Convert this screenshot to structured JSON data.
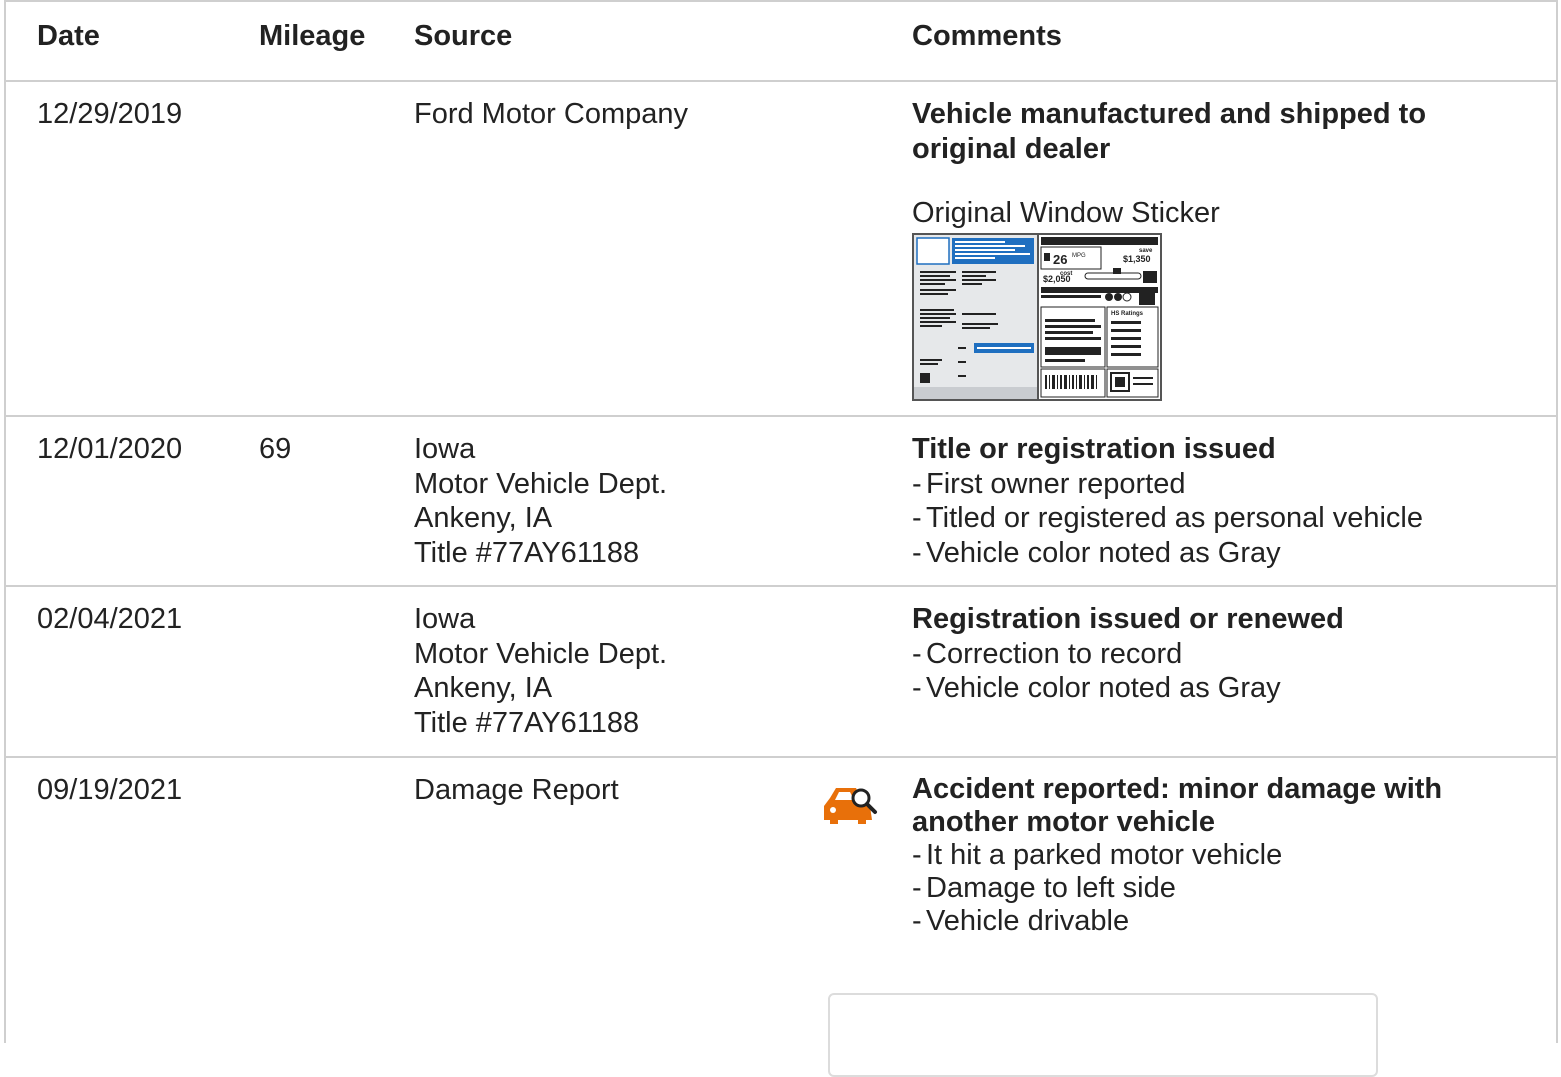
{
  "headers": {
    "date": "Date",
    "mileage": "Mileage",
    "source": "Source",
    "comments": "Comments"
  },
  "rows": [
    {
      "date": "12/29/2019",
      "mileage": "",
      "source": [
        "Ford Motor Company"
      ],
      "title": "Vehicle manufactured and shipped to original dealer",
      "title_lines": [
        "Vehicle manufactured and shipped to",
        "original dealer"
      ],
      "link": "Original Window Sticker",
      "sticker": {
        "mpg": "26",
        "mpg_unit": "MPG",
        "save": "save",
        "save_amount": "$1,350",
        "cost_label": "cost",
        "cost": "$2,050",
        "ratings": "HS Ratings"
      }
    },
    {
      "date": "12/01/2020",
      "mileage": "69",
      "source": [
        "Iowa",
        "Motor Vehicle Dept.",
        "Ankeny, IA",
        "Title #77AY61188"
      ],
      "title": "Title or registration issued",
      "bullets": [
        "First owner reported",
        "Titled or registered as personal vehicle",
        "Vehicle color noted as Gray"
      ]
    },
    {
      "date": "02/04/2021",
      "mileage": "",
      "source": [
        "Iowa",
        "Motor Vehicle Dept.",
        "Ankeny, IA",
        "Title #77AY61188"
      ],
      "title": "Registration issued or renewed",
      "bullets": [
        "Correction to record",
        "Vehicle color noted as Gray"
      ]
    },
    {
      "date": "09/19/2021",
      "mileage": "",
      "source": [
        "Damage Report"
      ],
      "icon": "car-search-icon",
      "title_lines": [
        "Accident reported: minor damage with",
        "another motor vehicle"
      ],
      "bullets": [
        "It hit a parked motor vehicle",
        "Damage to left side",
        "Vehicle drivable"
      ]
    }
  ],
  "colors": {
    "border": "#cfcfcf",
    "text": "#222222",
    "accent_blue": "#1f6fc0",
    "icon_orange": "#e8700a"
  },
  "bullet_dash": "-"
}
